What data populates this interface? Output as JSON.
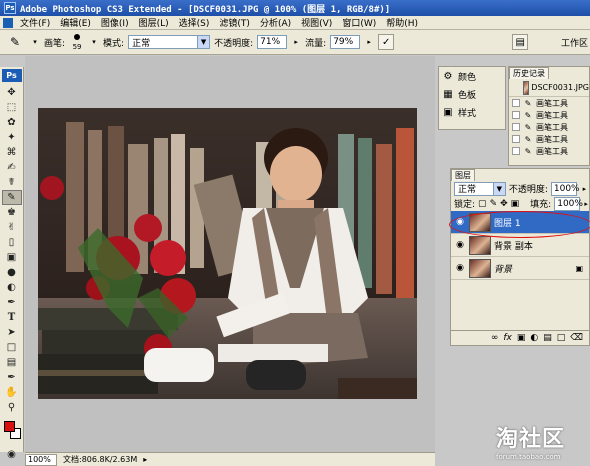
{
  "window": {
    "title": "Adobe Photoshop CS3 Extended - [DSCF0031.JPG @ 100% (图层 1, RGB/8#)]",
    "app_badge": "Ps"
  },
  "menu": [
    "文件(F)",
    "编辑(E)",
    "图像(I)",
    "图层(L)",
    "选择(S)",
    "滤镜(T)",
    "分析(A)",
    "视图(V)",
    "窗口(W)",
    "帮助(H)"
  ],
  "options": {
    "brush_label": "画笔:",
    "brush_size": "59",
    "mode_label": "模式:",
    "mode_value": "正常",
    "opacity_label": "不透明度:",
    "opacity_value": "71%",
    "flow_label": "流量:",
    "flow_value": "79%",
    "workspace_label": "工作区"
  },
  "tools": {
    "logo": "Ps",
    "icons": [
      "move-icon",
      "marquee-icon",
      "lasso-icon",
      "quick-select-icon",
      "crop-icon",
      "eyedropper-icon",
      "healing-icon",
      "brush-icon",
      "clone-stamp-icon",
      "history-brush-icon",
      "eraser-icon",
      "gradient-icon",
      "blur-icon",
      "dodge-icon",
      "pen-icon",
      "type-icon",
      "path-select-icon",
      "shape-icon",
      "notes-icon",
      "eyedropper2-icon",
      "hand-icon",
      "zoom-icon"
    ],
    "fg_color": "#d81010",
    "bg_color": "#ffffff"
  },
  "dock": {
    "items": [
      {
        "icon": "swatch-icon",
        "label": "颜色"
      },
      {
        "icon": "palette-icon",
        "label": "色板"
      },
      {
        "icon": "style-icon",
        "label": "样式"
      }
    ]
  },
  "history": {
    "tab": "历史记录",
    "snapshot": "DSCF0031.JPG",
    "items": [
      "画笔工具",
      "画笔工具",
      "画笔工具",
      "画笔工具",
      "画笔工具"
    ]
  },
  "layers": {
    "tab": "图层",
    "blend_mode": "正常",
    "opacity_label": "不透明度:",
    "opacity_value": "100%",
    "lock_label": "锁定:",
    "fill_label": "填充:",
    "fill_value": "100%",
    "list": [
      {
        "name": "图层 1",
        "selected": true
      },
      {
        "name": "背景 副本",
        "selected": false
      },
      {
        "name": "背景",
        "selected": false,
        "locked": true
      }
    ],
    "highlight_color": "#e01010"
  },
  "status": {
    "zoom": "100%",
    "doc_info": "文档:806.8K/2.63M"
  },
  "watermark": {
    "main": "淘社区",
    "sub": "forum.taobao.com"
  }
}
